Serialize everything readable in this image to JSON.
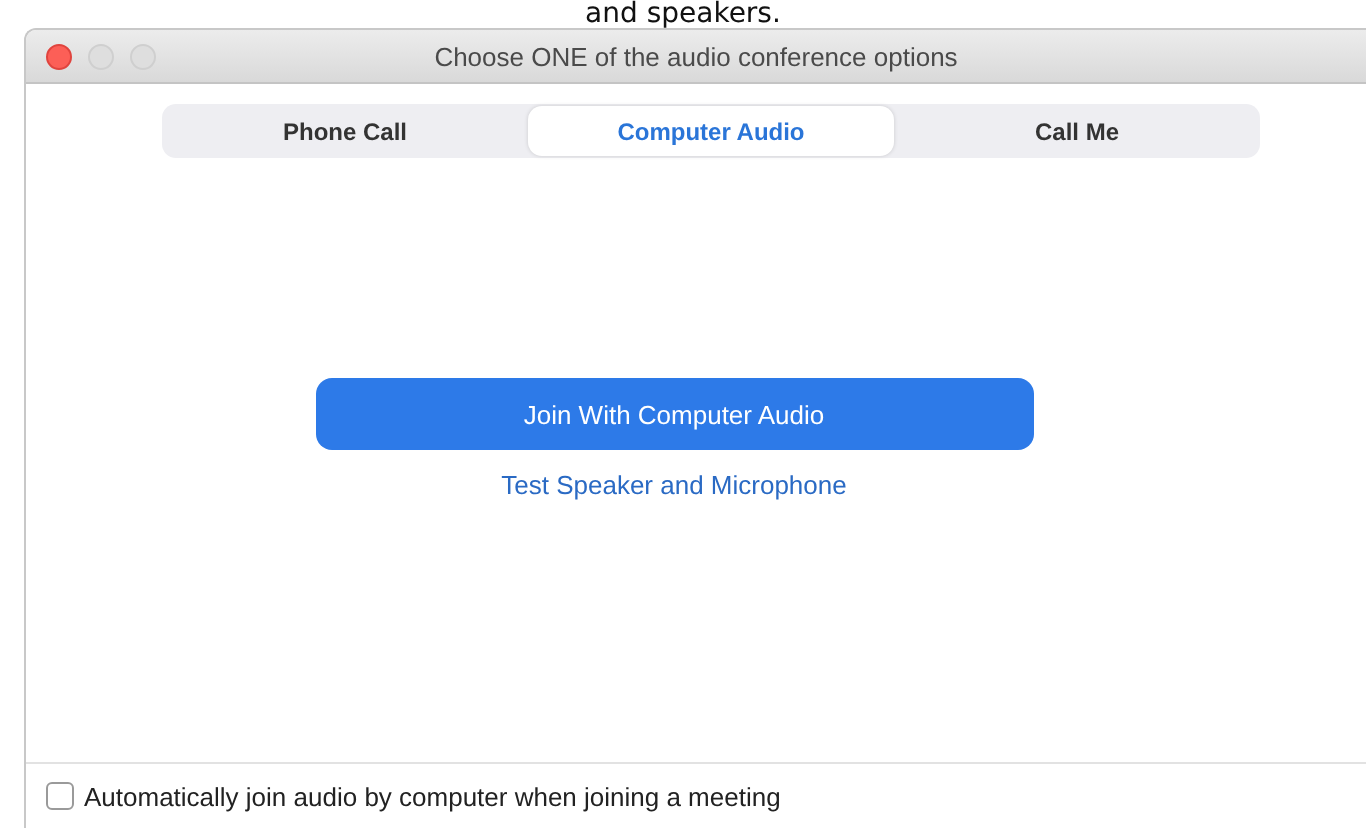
{
  "caption": "and speakers.",
  "window": {
    "title": "Choose ONE of the audio conference options"
  },
  "tabs": [
    {
      "label": "Phone Call",
      "selected": false
    },
    {
      "label": "Computer Audio",
      "selected": true
    },
    {
      "label": "Call Me",
      "selected": false
    }
  ],
  "join_button": "Join With Computer Audio",
  "test_link": "Test Speaker and Microphone",
  "auto_join": {
    "label": "Automatically join audio by computer when joining a meeting",
    "checked": false
  }
}
